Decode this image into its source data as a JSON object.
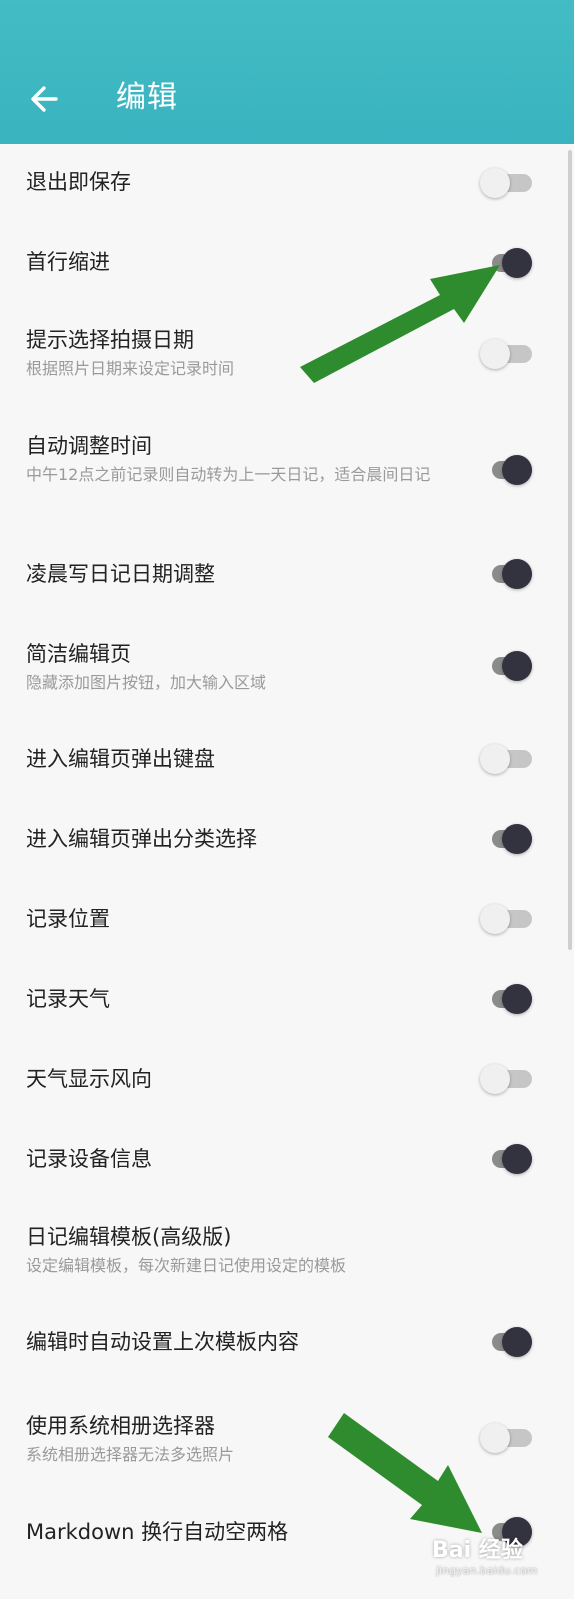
{
  "header": {
    "back_icon": "arrow-left-icon",
    "title": "编辑",
    "background": "#3cb6c1"
  },
  "settings": [
    {
      "label": "退出即保存",
      "sub": "",
      "on": false
    },
    {
      "label": "首行缩进",
      "sub": "",
      "on": true
    },
    {
      "label": "提示选择拍摄日期",
      "sub": "根据照片日期来设定记录时间",
      "on": false
    },
    {
      "label": "自动调整时间",
      "sub": "中午12点之前记录则自动转为上一天日记，适合晨间日记",
      "on": true
    },
    {
      "label": "凌晨写日记日期调整",
      "sub": "",
      "on": true
    },
    {
      "label": "简洁编辑页",
      "sub": "隐藏添加图片按钮，加大输入区域",
      "on": true
    },
    {
      "label": "进入编辑页弹出键盘",
      "sub": "",
      "on": false
    },
    {
      "label": "进入编辑页弹出分类选择",
      "sub": "",
      "on": true
    },
    {
      "label": "记录位置",
      "sub": "",
      "on": false
    },
    {
      "label": "记录天气",
      "sub": "",
      "on": true
    },
    {
      "label": "天气显示风向",
      "sub": "",
      "on": false
    },
    {
      "label": "记录设备信息",
      "sub": "",
      "on": true
    },
    {
      "label": "日记编辑模板(高级版)",
      "sub": "设定编辑模板，每次新建日记使用设定的模板",
      "on": null
    },
    {
      "label": "编辑时自动设置上次模板内容",
      "sub": "",
      "on": true
    },
    {
      "label": "使用系统相册选择器",
      "sub": "系统相册选择器无法多选照片",
      "on": false
    },
    {
      "label": "Markdown 换行自动空两格",
      "sub": "",
      "on": true
    }
  ],
  "colors": {
    "toggle_on_thumb": "#33333f",
    "toggle_off_thumb": "#f0f0f0",
    "annotation_arrow": "#2e8b2e"
  },
  "watermark": {
    "text": "Bai 经验",
    "sub": "jingyan.baidu.com"
  }
}
